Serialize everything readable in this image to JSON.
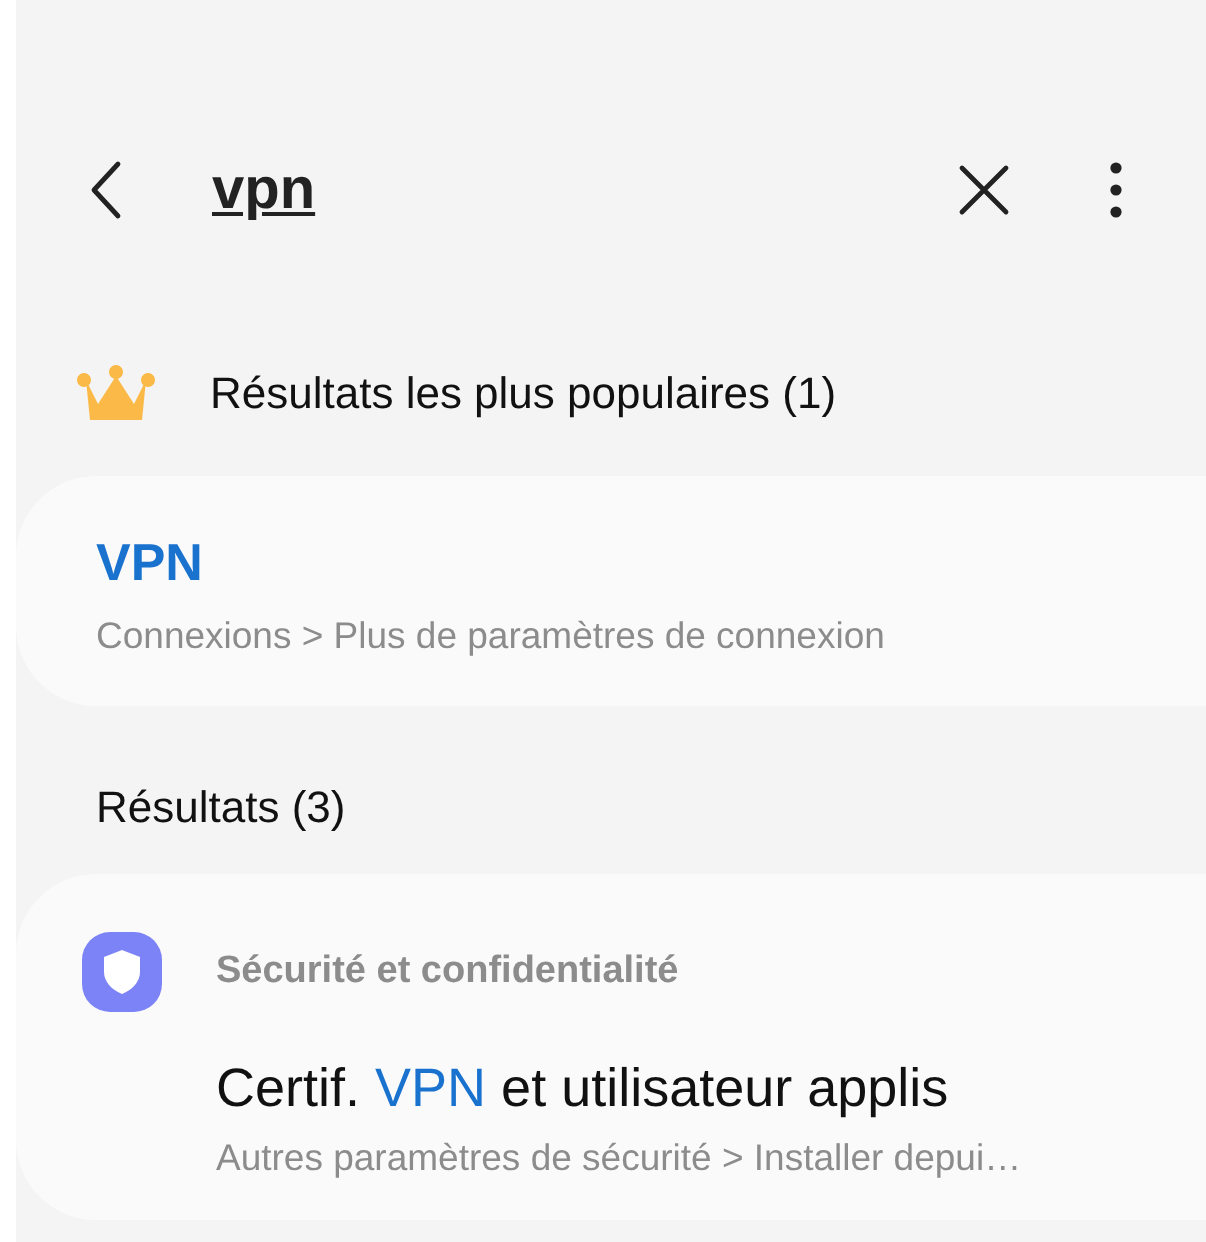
{
  "search_bar": {
    "query": "vpn"
  },
  "top_results": {
    "heading": "Résultats les plus populaires (1)",
    "items": [
      {
        "title": [
          {
            "text": "VPN",
            "highlight": true
          }
        ],
        "path": "Connexions > Plus de paramètres de connexion"
      }
    ]
  },
  "results": {
    "heading": "Résultats (3)",
    "groups": [
      {
        "category": "Sécurité et confidentialité",
        "items": [
          {
            "title": [
              {
                "text": "Certif. ",
                "highlight": false
              },
              {
                "text": "VPN",
                "highlight": true
              },
              {
                "text": " et utilisateur applis",
                "highlight": false
              }
            ],
            "path": "Autres paramètres de sécurité > Installer depui…"
          }
        ]
      }
    ]
  }
}
